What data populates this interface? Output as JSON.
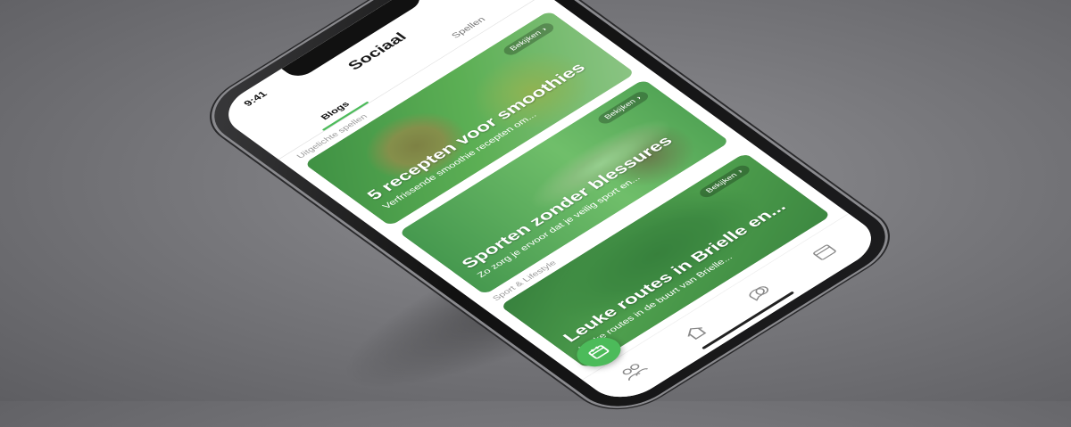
{
  "status_bar": {
    "time": "9:41"
  },
  "header": {
    "title": "Sociaal"
  },
  "tabs": [
    {
      "label": "Blogs",
      "active": true
    },
    {
      "label": "Spellen",
      "active": false
    }
  ],
  "sections": {
    "featured": "Uitgelichte spellen",
    "sport": "Sport & Lifestyle"
  },
  "cards": [
    {
      "title": "5 recepten voor smoothies",
      "subtitle": "Verfrissende smoothie recepten om...",
      "button": "Bekijken"
    },
    {
      "title": "Sporten zonder blessures",
      "subtitle": "Zo zorg je ervoor dat je veilig sport en...",
      "button": "Bekijken"
    },
    {
      "title": "Leuke routes in Brielle en...",
      "subtitle": "Leuke routes in de buurt van Brielle...",
      "button": "Bekijken"
    }
  ],
  "tabbar": {
    "icons": [
      "friends-icon",
      "home-icon",
      "chat-icon",
      "calendar-icon"
    ]
  },
  "colors": {
    "accent": "#4cbb5a",
    "background": "#7a7a7e",
    "phone_body": "#1a1a1a"
  }
}
